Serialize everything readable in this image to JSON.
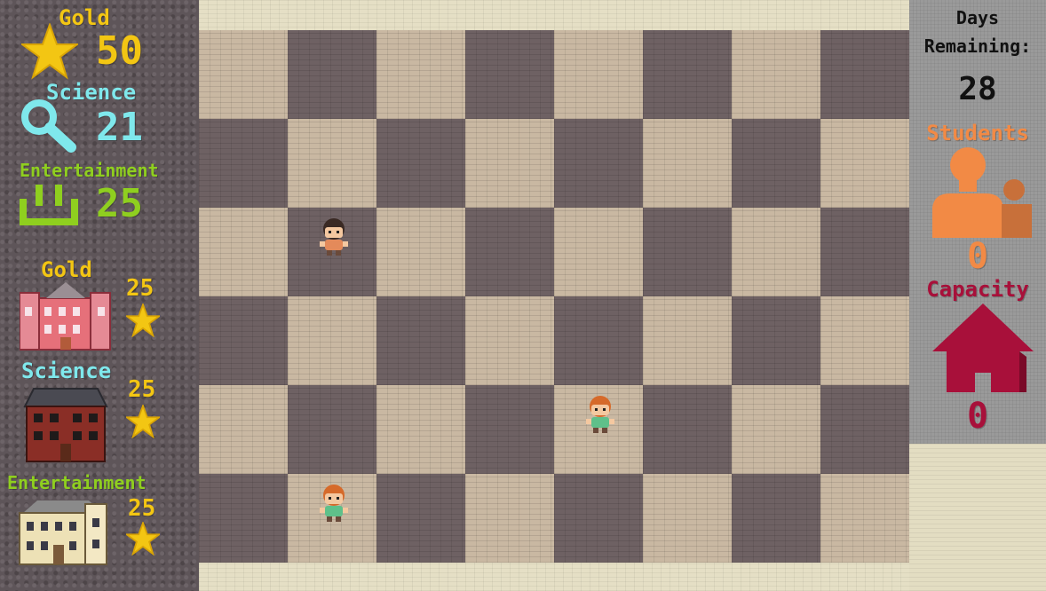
{
  "resources": {
    "gold": {
      "label": "Gold",
      "value": "50",
      "color": "#f3c613"
    },
    "science": {
      "label": "Science",
      "value": "21",
      "color": "#7fe8ec"
    },
    "entertainment": {
      "label": "Entertainment",
      "value": "25",
      "color": "#8fcf1f"
    }
  },
  "buildings": [
    {
      "label": "Gold",
      "cost": "25",
      "icon": "gold-building-icon",
      "label_color": "#f3c613"
    },
    {
      "label": "Science",
      "cost": "25",
      "icon": "science-building-icon",
      "label_color": "#7fe8ec"
    },
    {
      "label": "Entertainment",
      "cost": "25",
      "icon": "entertainment-building-icon",
      "label_color": "#8fcf1f"
    }
  ],
  "status": {
    "days_label_1": "Days",
    "days_label_2": "Remaining:",
    "days_value": "28",
    "students_label": "Students",
    "students_value": "0",
    "students_color": "#f28a45",
    "capacity_label": "Capacity",
    "capacity_value": "0",
    "capacity_color": "#a8103a"
  },
  "board": {
    "columns": 8,
    "rows": 6
  },
  "students": [
    {
      "name": "student-girl",
      "col": 1,
      "row": 2,
      "hair": "#3a2a24",
      "shirt": "#e48a5a"
    },
    {
      "name": "student-boy-a",
      "col": 4,
      "row": 4,
      "hair": "#d66a2a",
      "shirt": "#5fc08a"
    },
    {
      "name": "student-boy-b",
      "col": 1,
      "row": 5,
      "hair": "#d66a2a",
      "shirt": "#5fc08a"
    }
  ]
}
